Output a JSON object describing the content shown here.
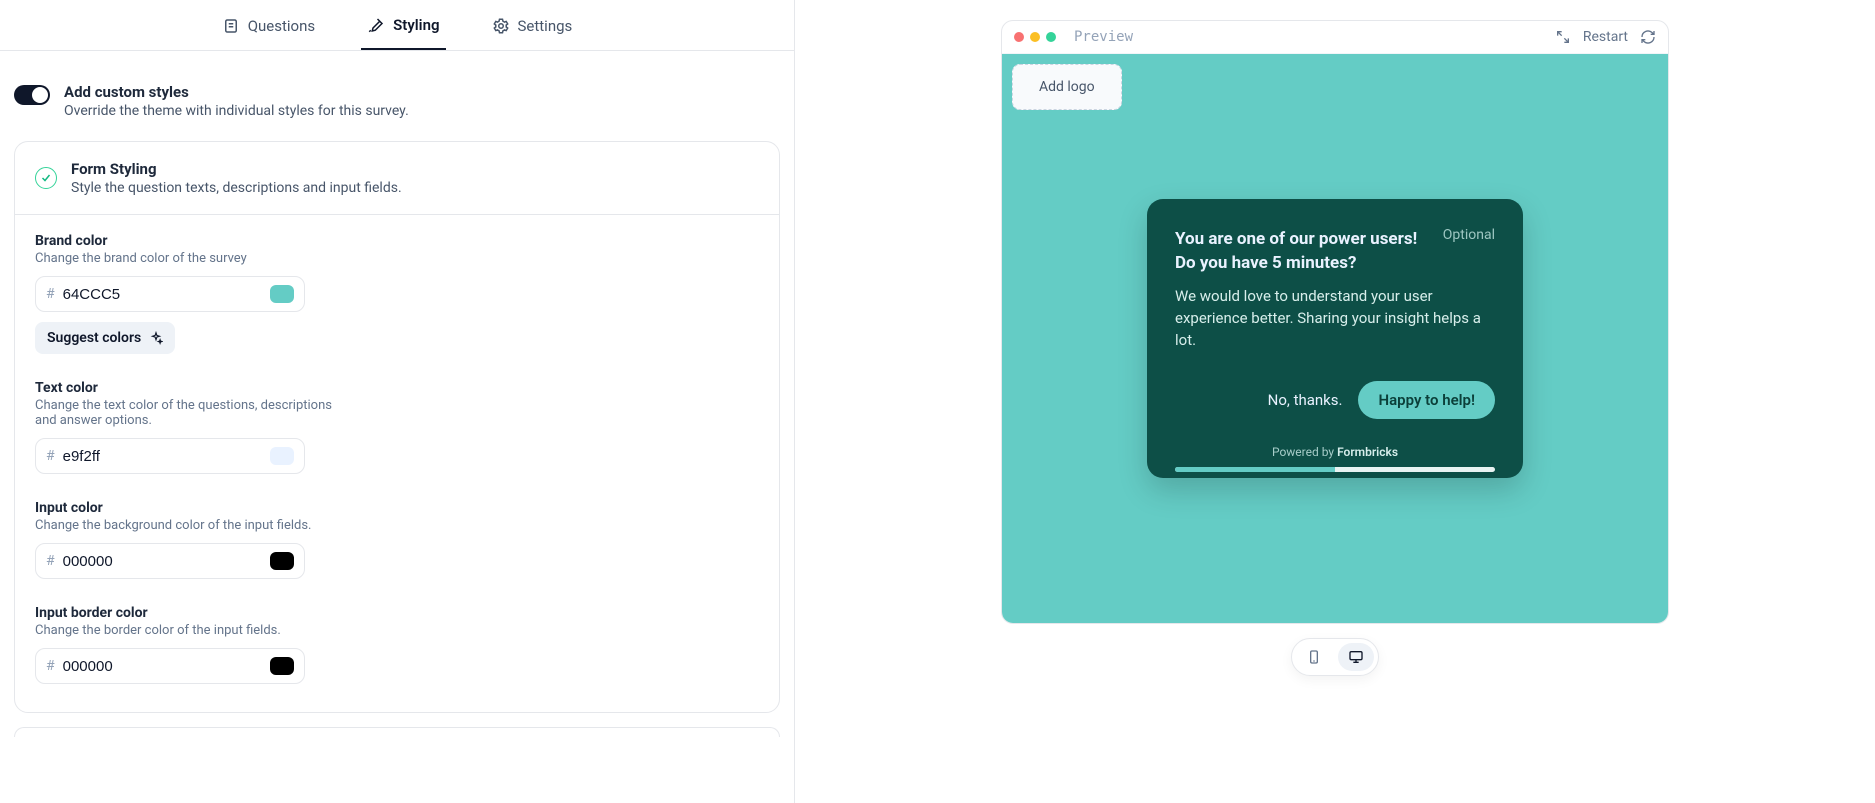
{
  "tabs": {
    "questions": "Questions",
    "styling": "Styling",
    "settings": "Settings"
  },
  "customStyles": {
    "title": "Add custom styles",
    "desc": "Override the theme with individual styles for this survey."
  },
  "formStyling": {
    "title": "Form Styling",
    "desc": "Style the question texts, descriptions and input fields."
  },
  "brand": {
    "label": "Brand color",
    "desc": "Change the brand color of the survey",
    "value": "64CCC5",
    "swatch": "#64CCC5"
  },
  "suggest": "Suggest colors",
  "text": {
    "label": "Text color",
    "desc": "Change the text color of the questions, descriptions and answer options.",
    "value": "e9f2ff",
    "swatch": "#e9f2ff"
  },
  "input": {
    "label": "Input color",
    "desc": "Change the background color of the input fields.",
    "value": "000000",
    "swatch": "#000000"
  },
  "inputBorder": {
    "label": "Input border color",
    "desc": "Change the border color of the input fields.",
    "value": "000000",
    "swatch": "#000000"
  },
  "preview": {
    "label": "Preview",
    "restart": "Restart",
    "addLogo": "Add logo",
    "question": "You are one of our power users! Do you have 5 minutes?",
    "optional": "Optional",
    "description": "We would love to understand your user experience better. Sharing your insight helps a lot.",
    "noThanks": "No, thanks.",
    "happy": "Happy to help!",
    "poweredPrefix": "Powered by ",
    "poweredBrand": "Formbricks"
  }
}
